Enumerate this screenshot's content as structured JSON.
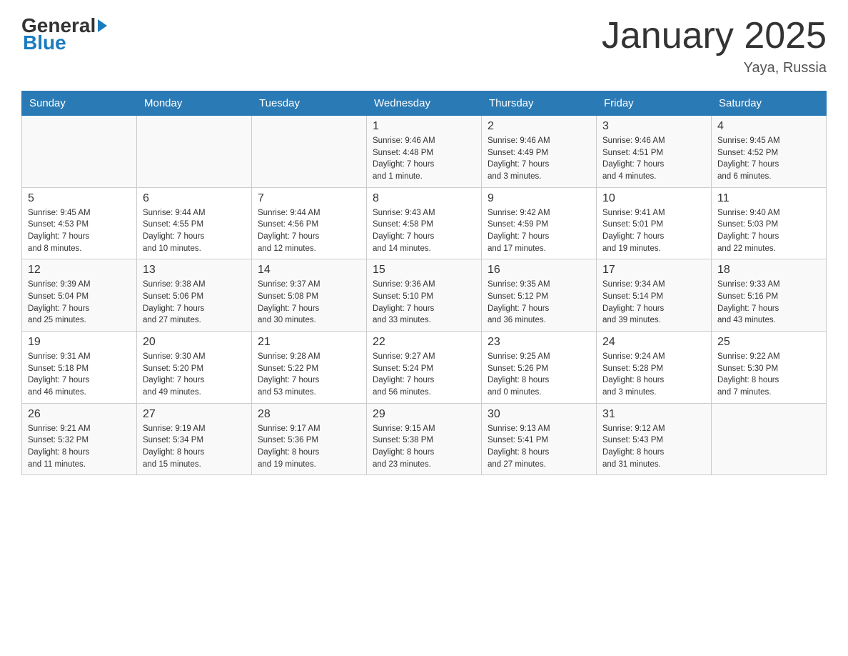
{
  "header": {
    "logo_text": "General",
    "logo_blue": "Blue",
    "month_title": "January 2025",
    "location": "Yaya, Russia"
  },
  "weekdays": [
    "Sunday",
    "Monday",
    "Tuesday",
    "Wednesday",
    "Thursday",
    "Friday",
    "Saturday"
  ],
  "weeks": [
    [
      {
        "day": "",
        "info": ""
      },
      {
        "day": "",
        "info": ""
      },
      {
        "day": "",
        "info": ""
      },
      {
        "day": "1",
        "info": "Sunrise: 9:46 AM\nSunset: 4:48 PM\nDaylight: 7 hours\nand 1 minute."
      },
      {
        "day": "2",
        "info": "Sunrise: 9:46 AM\nSunset: 4:49 PM\nDaylight: 7 hours\nand 3 minutes."
      },
      {
        "day": "3",
        "info": "Sunrise: 9:46 AM\nSunset: 4:51 PM\nDaylight: 7 hours\nand 4 minutes."
      },
      {
        "day": "4",
        "info": "Sunrise: 9:45 AM\nSunset: 4:52 PM\nDaylight: 7 hours\nand 6 minutes."
      }
    ],
    [
      {
        "day": "5",
        "info": "Sunrise: 9:45 AM\nSunset: 4:53 PM\nDaylight: 7 hours\nand 8 minutes."
      },
      {
        "day": "6",
        "info": "Sunrise: 9:44 AM\nSunset: 4:55 PM\nDaylight: 7 hours\nand 10 minutes."
      },
      {
        "day": "7",
        "info": "Sunrise: 9:44 AM\nSunset: 4:56 PM\nDaylight: 7 hours\nand 12 minutes."
      },
      {
        "day": "8",
        "info": "Sunrise: 9:43 AM\nSunset: 4:58 PM\nDaylight: 7 hours\nand 14 minutes."
      },
      {
        "day": "9",
        "info": "Sunrise: 9:42 AM\nSunset: 4:59 PM\nDaylight: 7 hours\nand 17 minutes."
      },
      {
        "day": "10",
        "info": "Sunrise: 9:41 AM\nSunset: 5:01 PM\nDaylight: 7 hours\nand 19 minutes."
      },
      {
        "day": "11",
        "info": "Sunrise: 9:40 AM\nSunset: 5:03 PM\nDaylight: 7 hours\nand 22 minutes."
      }
    ],
    [
      {
        "day": "12",
        "info": "Sunrise: 9:39 AM\nSunset: 5:04 PM\nDaylight: 7 hours\nand 25 minutes."
      },
      {
        "day": "13",
        "info": "Sunrise: 9:38 AM\nSunset: 5:06 PM\nDaylight: 7 hours\nand 27 minutes."
      },
      {
        "day": "14",
        "info": "Sunrise: 9:37 AM\nSunset: 5:08 PM\nDaylight: 7 hours\nand 30 minutes."
      },
      {
        "day": "15",
        "info": "Sunrise: 9:36 AM\nSunset: 5:10 PM\nDaylight: 7 hours\nand 33 minutes."
      },
      {
        "day": "16",
        "info": "Sunrise: 9:35 AM\nSunset: 5:12 PM\nDaylight: 7 hours\nand 36 minutes."
      },
      {
        "day": "17",
        "info": "Sunrise: 9:34 AM\nSunset: 5:14 PM\nDaylight: 7 hours\nand 39 minutes."
      },
      {
        "day": "18",
        "info": "Sunrise: 9:33 AM\nSunset: 5:16 PM\nDaylight: 7 hours\nand 43 minutes."
      }
    ],
    [
      {
        "day": "19",
        "info": "Sunrise: 9:31 AM\nSunset: 5:18 PM\nDaylight: 7 hours\nand 46 minutes."
      },
      {
        "day": "20",
        "info": "Sunrise: 9:30 AM\nSunset: 5:20 PM\nDaylight: 7 hours\nand 49 minutes."
      },
      {
        "day": "21",
        "info": "Sunrise: 9:28 AM\nSunset: 5:22 PM\nDaylight: 7 hours\nand 53 minutes."
      },
      {
        "day": "22",
        "info": "Sunrise: 9:27 AM\nSunset: 5:24 PM\nDaylight: 7 hours\nand 56 minutes."
      },
      {
        "day": "23",
        "info": "Sunrise: 9:25 AM\nSunset: 5:26 PM\nDaylight: 8 hours\nand 0 minutes."
      },
      {
        "day": "24",
        "info": "Sunrise: 9:24 AM\nSunset: 5:28 PM\nDaylight: 8 hours\nand 3 minutes."
      },
      {
        "day": "25",
        "info": "Sunrise: 9:22 AM\nSunset: 5:30 PM\nDaylight: 8 hours\nand 7 minutes."
      }
    ],
    [
      {
        "day": "26",
        "info": "Sunrise: 9:21 AM\nSunset: 5:32 PM\nDaylight: 8 hours\nand 11 minutes."
      },
      {
        "day": "27",
        "info": "Sunrise: 9:19 AM\nSunset: 5:34 PM\nDaylight: 8 hours\nand 15 minutes."
      },
      {
        "day": "28",
        "info": "Sunrise: 9:17 AM\nSunset: 5:36 PM\nDaylight: 8 hours\nand 19 minutes."
      },
      {
        "day": "29",
        "info": "Sunrise: 9:15 AM\nSunset: 5:38 PM\nDaylight: 8 hours\nand 23 minutes."
      },
      {
        "day": "30",
        "info": "Sunrise: 9:13 AM\nSunset: 5:41 PM\nDaylight: 8 hours\nand 27 minutes."
      },
      {
        "day": "31",
        "info": "Sunrise: 9:12 AM\nSunset: 5:43 PM\nDaylight: 8 hours\nand 31 minutes."
      },
      {
        "day": "",
        "info": ""
      }
    ]
  ]
}
